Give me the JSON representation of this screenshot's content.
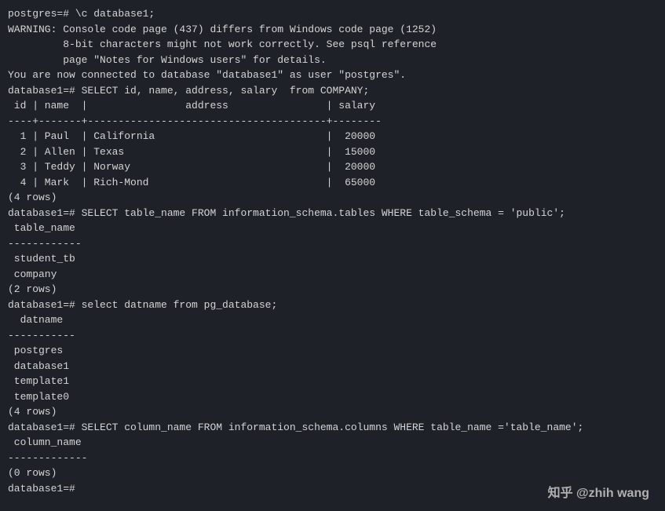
{
  "terminal": {
    "lines": [
      {
        "id": "line1",
        "text": "postgres=# \\c database1;"
      },
      {
        "id": "line2",
        "text": "WARNING: Console code page (437) differs from Windows code page (1252)"
      },
      {
        "id": "line3",
        "text": "         8-bit characters might not work correctly. See psql reference"
      },
      {
        "id": "line4",
        "text": "         page \"Notes for Windows users\" for details."
      },
      {
        "id": "line5",
        "text": "You are now connected to database \"database1\" as user \"postgres\"."
      },
      {
        "id": "line6",
        "text": "database1=# SELECT id, name, address, salary  from COMPANY;"
      },
      {
        "id": "line7",
        "text": " id | name  |                address                | salary "
      },
      {
        "id": "line8",
        "text": "----+-------+---------------------------------------+--------"
      },
      {
        "id": "line9",
        "text": "  1 | Paul  | California                            |  20000"
      },
      {
        "id": "line10",
        "text": "  2 | Allen | Texas                                 |  15000"
      },
      {
        "id": "line11",
        "text": "  3 | Teddy | Norway                                |  20000"
      },
      {
        "id": "line12",
        "text": "  4 | Mark  | Rich-Mond                             |  65000"
      },
      {
        "id": "line13",
        "text": "(4 rows)"
      },
      {
        "id": "line14",
        "text": ""
      },
      {
        "id": "line15",
        "text": ""
      },
      {
        "id": "line16",
        "text": "database1=# SELECT table_name FROM information_schema.tables WHERE table_schema = 'public';"
      },
      {
        "id": "line17",
        "text": " table_name "
      },
      {
        "id": "line18",
        "text": "------------"
      },
      {
        "id": "line19",
        "text": " student_tb"
      },
      {
        "id": "line20",
        "text": " company"
      },
      {
        "id": "line21",
        "text": "(2 rows)"
      },
      {
        "id": "line22",
        "text": ""
      },
      {
        "id": "line23",
        "text": ""
      },
      {
        "id": "line24",
        "text": "database1=# select datname from pg_database;"
      },
      {
        "id": "line25",
        "text": "  datname  "
      },
      {
        "id": "line26",
        "text": "-----------"
      },
      {
        "id": "line27",
        "text": " postgres"
      },
      {
        "id": "line28",
        "text": " database1"
      },
      {
        "id": "line29",
        "text": " template1"
      },
      {
        "id": "line30",
        "text": " template0"
      },
      {
        "id": "line31",
        "text": "(4 rows)"
      },
      {
        "id": "line32",
        "text": ""
      },
      {
        "id": "line33",
        "text": ""
      },
      {
        "id": "line34",
        "text": "database1=# SELECT column_name FROM information_schema.columns WHERE table_name ='table_name';"
      },
      {
        "id": "line35",
        "text": " column_name "
      },
      {
        "id": "line36",
        "text": "-------------"
      },
      {
        "id": "line37",
        "text": "(0 rows)"
      },
      {
        "id": "line38",
        "text": ""
      },
      {
        "id": "line39",
        "text": ""
      },
      {
        "id": "line40",
        "text": "database1=# "
      }
    ]
  },
  "watermark": {
    "text": "知乎 @zhih wang"
  }
}
